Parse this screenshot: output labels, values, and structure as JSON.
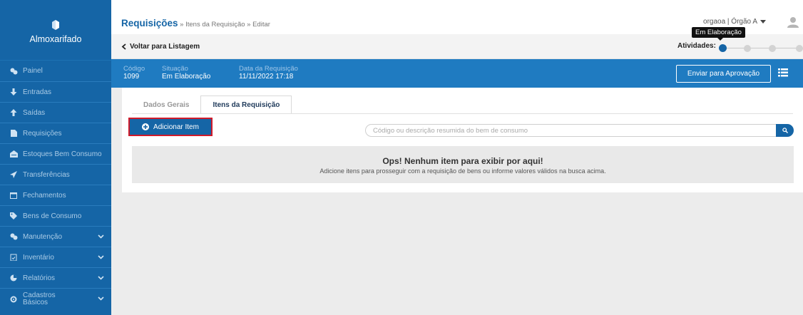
{
  "app": {
    "brand": "Almoxarifado"
  },
  "sidebar": {
    "items": [
      {
        "label": "Painel",
        "icon": "dashboard-icon"
      },
      {
        "label": "Entradas",
        "icon": "arrow-down-icon"
      },
      {
        "label": "Saídas",
        "icon": "arrow-up-icon"
      },
      {
        "label": "Requisições",
        "icon": "document-icon"
      },
      {
        "label": "Estoques Bem Consumo",
        "icon": "warehouse-icon"
      },
      {
        "label": "Transferências",
        "icon": "send-icon"
      },
      {
        "label": "Fechamentos",
        "icon": "calendar-icon"
      },
      {
        "label": "Bens de Consumo",
        "icon": "tag-icon"
      },
      {
        "label": "Manutenção",
        "icon": "gears-icon",
        "expandable": true
      },
      {
        "label": "Inventário",
        "icon": "clipboard-icon",
        "expandable": true
      },
      {
        "label": "Relatórios",
        "icon": "pie-chart-icon",
        "expandable": true
      },
      {
        "label_line1": "Cadastros",
        "label_line2": "Básicos",
        "icon": "gear-icon",
        "expandable": true
      }
    ]
  },
  "header": {
    "breadcrumb_main": "Requisições",
    "breadcrumb_rest": " » Itens da Requisição » Editar",
    "user": "orgaoa | Órgão A"
  },
  "subbar": {
    "back_label": "Voltar para Listagem",
    "activities_label": "Atividades:",
    "tooltip": "Em Elaboração",
    "steps_total": 4,
    "active_step": 1
  },
  "info": {
    "codigo_label": "Código",
    "codigo_value": "1099",
    "situacao_label": "Situação",
    "situacao_value": "Em Elaboração",
    "data_label": "Data da Requisição",
    "data_value": "11/11/2022 17:18",
    "send_button": "Enviar para Aprovação"
  },
  "tabs": [
    {
      "label": "Dados Gerais",
      "active": false
    },
    {
      "label": "Itens da Requisição",
      "active": true
    }
  ],
  "content": {
    "add_button": "Adicionar Item",
    "search_placeholder": "Código ou descrição resumida do bem de consumo",
    "empty_title": "Ops! Nenhum item para exibir por aqui!",
    "empty_message": "Adicione itens para prosseguir com a requisição de bens ou informe valores válidos na busca acima."
  },
  "colors": {
    "sidebar": "#1565a6",
    "infobar": "#1f7bc1",
    "accent": "#1565a6",
    "highlight_outline": "#d01a2a"
  }
}
